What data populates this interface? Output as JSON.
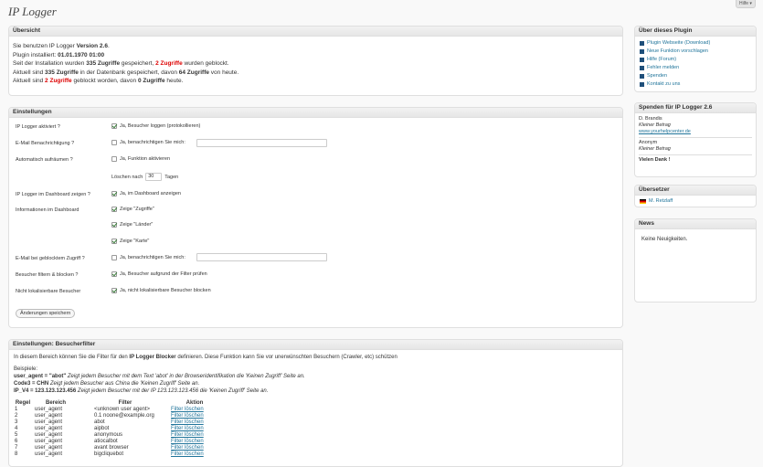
{
  "page_title": "IP Logger",
  "help_label": "Hilfe ▾",
  "overview": {
    "title": "Übersicht",
    "line1_pre": "Sie benutzen IP Logger ",
    "line1_ver": "Version 2.6",
    "line1_post": ".",
    "line2_pre": "Plugin installiert: ",
    "line2_date": "01.01.1970 01:00",
    "line3_a": "Seit der Installation wurden ",
    "line3_b": "335 Zugriffe",
    "line3_c": " gespeichert, ",
    "line3_d": "2 Zugriffe",
    "line3_e": " wurden geblockt.",
    "line4_a": "Aktuell sind ",
    "line4_b": "335 Zugriffe",
    "line4_c": " in der Datenbank gespeichert, davon ",
    "line4_d": "64 Zugriffe",
    "line4_e": " von heute.",
    "line5_a": "Aktuell sind ",
    "line5_b": "2 Zugriffe",
    "line5_c": " geblockt worden, davon ",
    "line5_d": "0 Zugriffe",
    "line5_e": " heute."
  },
  "settings": {
    "title": "Einstellungen",
    "l_active": "IP Logger aktiviert ?",
    "o_active": "Ja, Besucher loggen (protokollieren)",
    "l_mail": "E-Mail Benachrichtigung ?",
    "o_mail": "Ja, benachrichtigen Sie mich:",
    "l_clean": "Automatisch aufräumen ?",
    "o_clean": "Ja, Funktion aktivieren",
    "del_pre": "Löschen nach",
    "del_days": "30",
    "del_post": "Tagen",
    "l_dash": "IP Logger im Dashboard zeigen ?",
    "o_dash": "Ja, im Dashboard anzeigen",
    "l_info": "Informationen im Dashboard",
    "o_info1": "Zeige \"Zugriffe\"",
    "o_info2": "Zeige \"Länder\"",
    "o_info3": "Zeige \"Karte\"",
    "l_blockmail": "E-Mail bei geblocktem Zugriff ?",
    "o_blockmail": "Ja, benachrichtigen Sie mich:",
    "l_filter": "Besucher filtern & blocken ?",
    "o_filter": "Ja, Besucher aufgrund der Filter prüfen",
    "l_nonloc": "Nicht lokalisierbare Besucher",
    "o_nonloc": "Ja, nicht lokalisierbare Besucher blocken",
    "save": "Änderungen speichern"
  },
  "filter": {
    "title": "Einstellungen: Besucherfilter",
    "intro_a": "In diesem Bereich können Sie die Filter für den ",
    "intro_b": "IP Logger Blocker",
    "intro_c": " definieren. Diese Funktion kann Sie vor unerwünschten Besuchern (Crawler, etc) schützen",
    "examples": "Beispiele:",
    "ex1_code": "user_agent = \"abot\"",
    "ex1_txt": " Zeigt jedem Besucher mit dem Text 'abot' in der Browseridentifikation die 'Keinen Zugriff' Seite an.",
    "ex2_code": "Code3 = CHN",
    "ex2_txt": " Zeigt jedem Besucher aus China die 'Keinen Zugriff' Seite an.",
    "ex3_code": "IP_V4 = 123.123.123.456",
    "ex3_txt": " Zeigt jedem Besucher mit der IP 123.123.123.456 die 'Keinen Zugriff' Seite an.",
    "headers": [
      "Regel",
      "Bereich",
      "Filter",
      "Aktion"
    ],
    "rows": [
      [
        "1",
        "user_agent",
        "<unknown user agent>",
        "Filter löschen"
      ],
      [
        "2",
        "user_agent",
        "0.1 noone@example.org",
        "Filter löschen"
      ],
      [
        "3",
        "user_agent",
        "abot",
        "Filter löschen"
      ],
      [
        "4",
        "user_agent",
        "aipbot",
        "Filter löschen"
      ],
      [
        "5",
        "user_agent",
        "anonymous",
        "Filter löschen"
      ],
      [
        "6",
        "user_agent",
        "atiocalbot",
        "Filter löschen"
      ],
      [
        "7",
        "user_agent",
        "avant browser",
        "Filter löschen"
      ],
      [
        "8",
        "user_agent",
        "bigcliquebot",
        "Filter löschen"
      ]
    ]
  },
  "about": {
    "title": "Über dieses Plugin",
    "links": [
      "Plugin Webseite (Download)",
      "Neue Funktion vorschlagen",
      "Hilfe (Forum)",
      "Fehler melden",
      "Spenden",
      "Kontakt zu uns"
    ]
  },
  "donate": {
    "title": "Spenden für IP Logger 2.6",
    "d1_name": "D. Brandis",
    "d1_amount": "Kleiner Betrag",
    "d1_url": "www.yourhelpcenter.de",
    "d2_name": "Anonym",
    "d2_amount": "Kleiner Betrag",
    "thanks": "Vielen Dank !"
  },
  "translators": {
    "title": "Übersetzer",
    "name": "M. Retzlaff"
  },
  "news": {
    "title": "News",
    "text": "Keine Neuigkeiten."
  }
}
